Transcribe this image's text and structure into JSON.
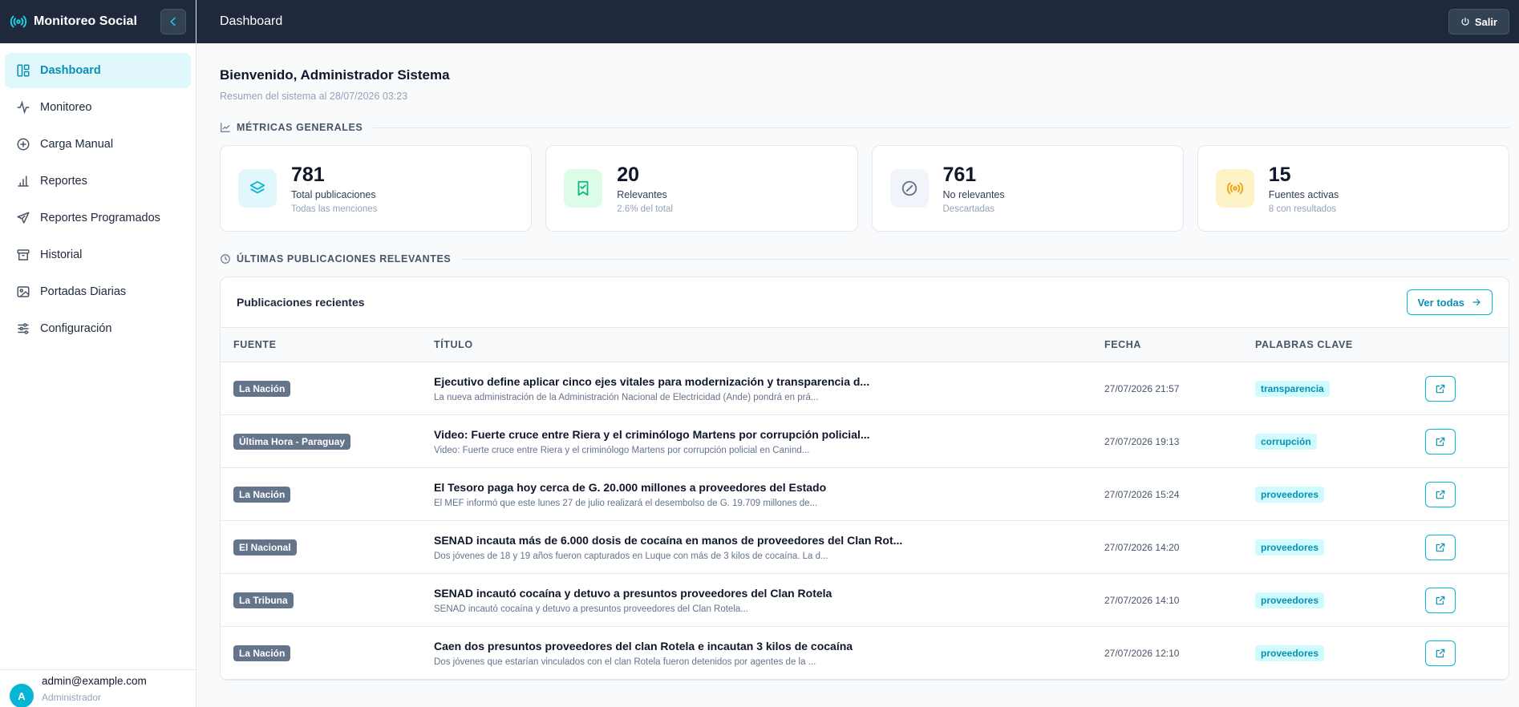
{
  "brand": {
    "title": "Monitoreo Social"
  },
  "sidebar": {
    "items": [
      {
        "label": "Dashboard",
        "icon": "dashboard-icon",
        "active": true
      },
      {
        "label": "Monitoreo",
        "icon": "activity-icon"
      },
      {
        "label": "Carga Manual",
        "icon": "plus-circle-icon"
      },
      {
        "label": "Reportes",
        "icon": "bar-chart-icon"
      },
      {
        "label": "Reportes Programados",
        "icon": "send-icon"
      },
      {
        "label": "Historial",
        "icon": "archive-icon"
      },
      {
        "label": "Portadas Diarias",
        "icon": "image-icon"
      },
      {
        "label": "Configuración",
        "icon": "sliders-icon"
      }
    ],
    "user": {
      "initial": "A",
      "email": "admin@example.com",
      "role": "Administrador"
    }
  },
  "topbar": {
    "title": "Dashboard",
    "logout_label": "Salir"
  },
  "main": {
    "welcome": "Bienvenido, Administrador Sistema",
    "subtitle": "Resumen del sistema al 28/07/2026 03:23",
    "metrics_section": "MÉTRICAS GENERALES",
    "metrics": [
      {
        "value": "781",
        "label": "Total publicaciones",
        "sub": "Todas las menciones",
        "icon": "layers-icon",
        "color": "#06b6d4",
        "bg": "#e0f7fb"
      },
      {
        "value": "20",
        "label": "Relevantes",
        "sub": "2.6% del total",
        "icon": "bookmark-check-icon",
        "color": "#10b981",
        "bg": "#dcfce7"
      },
      {
        "value": "761",
        "label": "No relevantes",
        "sub": "Descartadas",
        "icon": "ban-icon",
        "color": "#64748b",
        "bg": "#f1f5f9"
      },
      {
        "value": "15",
        "label": "Fuentes activas",
        "sub": "8 con resultados",
        "icon": "radio-icon",
        "color": "#f59e0b",
        "bg": "#fef3c7"
      }
    ],
    "recent_section": "ÚLTIMAS PUBLICACIONES RELEVANTES",
    "panel_title": "Publicaciones recientes",
    "see_all_label": "Ver todas",
    "columns": [
      "FUENTE",
      "TÍTULO",
      "FECHA",
      "PALABRAS CLAVE"
    ],
    "rows": [
      {
        "source": "La Nación",
        "title": "Ejecutivo define aplicar cinco ejes vitales para modernización y transparencia d...",
        "desc": "La nueva administración de la Administración Nacional de Electricidad (Ande) pondrá en prá...",
        "date": "27/07/2026 21:57",
        "keyword": "transparencia"
      },
      {
        "source": "Última Hora - Paraguay",
        "title": "Video: Fuerte cruce entre Riera y el criminólogo Martens por corrupción policial...",
        "desc": "Video: Fuerte cruce entre Riera y el criminólogo Martens por corrupción policial en Canind...",
        "date": "27/07/2026 19:13",
        "keyword": "corrupción"
      },
      {
        "source": "La Nación",
        "title": "El Tesoro paga hoy cerca de G. 20.000 millones a proveedores del Estado",
        "desc": "El MEF informó que este lunes 27 de julio realizará el desembolso de G. 19.709 millones de...",
        "date": "27/07/2026 15:24",
        "keyword": "proveedores"
      },
      {
        "source": "El Nacional",
        "title": "SENAD incauta más de 6.000 dosis de cocaína en manos de proveedores del Clan Rot...",
        "desc": "Dos jóvenes de 18 y 19 años fueron capturados en Luque con más de 3 kilos de cocaína. La d...",
        "date": "27/07/2026 14:20",
        "keyword": "proveedores"
      },
      {
        "source": "La Tribuna",
        "title": "SENAD incautó cocaína y detuvo a presuntos proveedores del Clan Rotela",
        "desc": "SENAD incautó cocaína y detuvo a presuntos proveedores del Clan Rotela...",
        "date": "27/07/2026 14:10",
        "keyword": "proveedores"
      },
      {
        "source": "La Nación",
        "title": "Caen dos presuntos proveedores del clan Rotela e incautan 3 kilos de cocaína",
        "desc": "Dos jóvenes que estarían vinculados con el clan Rotela fueron detenidos por agentes de la ...",
        "date": "27/07/2026 12:10",
        "keyword": "proveedores"
      }
    ]
  }
}
